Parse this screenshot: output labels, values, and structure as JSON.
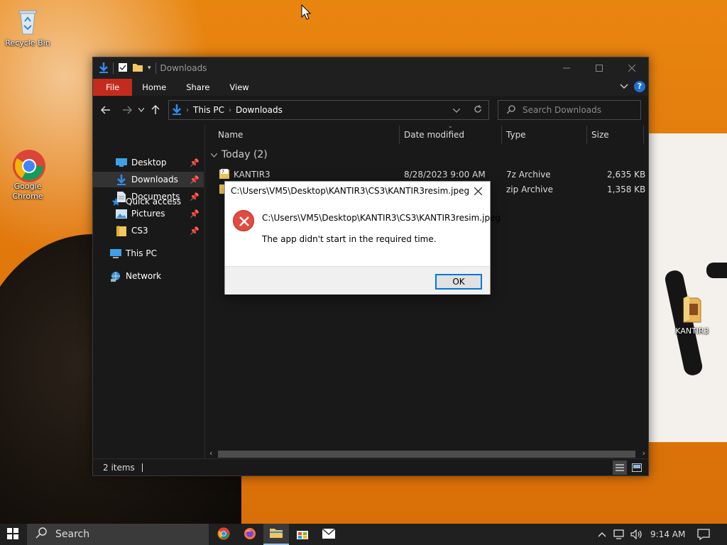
{
  "desktop": {
    "icons": [
      {
        "label": "Recycle Bin"
      },
      {
        "label": "Google Chrome"
      },
      {
        "label": "KANTIR3"
      }
    ]
  },
  "explorer": {
    "title": "Downloads",
    "ribbon_tabs": [
      "File",
      "Home",
      "Share",
      "View"
    ],
    "breadcrumb": [
      "This PC",
      "Downloads"
    ],
    "search_placeholder": "Search Downloads",
    "nav": {
      "quick_access": "Quick access",
      "items": [
        "Desktop",
        "Downloads",
        "Documents",
        "Pictures",
        "CS3"
      ],
      "this_pc": "This PC",
      "network": "Network"
    },
    "columns": [
      "Name",
      "Date modified",
      "Type",
      "Size"
    ],
    "group_label": "Today (2)",
    "files": [
      {
        "name": "KANTIR3",
        "date": "8/28/2023 9:00 AM",
        "type": "7z Archive",
        "size": "2,635 KB"
      },
      {
        "name": "",
        "date": "",
        "type": "zip Archive",
        "size": "1,358 KB"
      }
    ],
    "status": "2 items"
  },
  "dialog": {
    "title": "C:\\Users\\VM5\\Desktop\\KANTIR3\\CS3\\KANTIR3resim.jpeg",
    "heading": "C:\\Users\\VM5\\Desktop\\KANTIR3\\CS3\\KANTIR3resim.jpeg",
    "message": "The app didn't start in the required time.",
    "ok_label": "OK"
  },
  "taskbar": {
    "search_label": "Search",
    "time": "9:14 AM"
  },
  "colors": {
    "accent_red": "#c42b1c",
    "folder_yellow": "#f2c75c",
    "link_blue": "#1f6fd1"
  }
}
